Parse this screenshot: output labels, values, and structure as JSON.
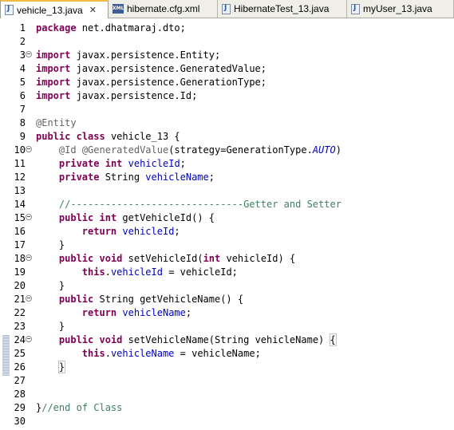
{
  "tabs": [
    {
      "label": "vehicle_13.java",
      "icon": "java-file-icon",
      "active": true,
      "close": "✕"
    },
    {
      "label": "hibernate.cfg.xml",
      "icon": "xml-file-icon",
      "active": false
    },
    {
      "label": "HibernateTest_13.java",
      "icon": "java-file-icon",
      "active": false
    },
    {
      "label": "myUser_13.java",
      "icon": "java-file-icon",
      "active": false
    }
  ],
  "xml_badge": "XML",
  "lines": [
    {
      "n": "1",
      "fold": false,
      "parts": [
        [
          "kw",
          "package"
        ],
        [
          "",
          "net.dhatmaraj.dto;"
        ]
      ],
      "html": "<span class='kw'>package</span> net.dhatmaraj.dto;"
    },
    {
      "n": "2",
      "fold": false,
      "parts": []
    },
    {
      "n": "3",
      "fold": true,
      "parts": []
    },
    {
      "n": "4",
      "fold": false,
      "parts": []
    },
    {
      "n": "5",
      "fold": false,
      "parts": []
    },
    {
      "n": "6",
      "fold": false,
      "parts": []
    },
    {
      "n": "7",
      "fold": false,
      "parts": []
    },
    {
      "n": "8",
      "fold": false,
      "parts": []
    },
    {
      "n": "9",
      "fold": false,
      "parts": []
    },
    {
      "n": "10",
      "fold": true,
      "parts": []
    },
    {
      "n": "11",
      "fold": false,
      "parts": []
    },
    {
      "n": "12",
      "fold": false,
      "parts": []
    },
    {
      "n": "13",
      "fold": false,
      "parts": []
    },
    {
      "n": "14",
      "fold": false,
      "parts": []
    },
    {
      "n": "15",
      "fold": true,
      "parts": []
    },
    {
      "n": "16",
      "fold": false,
      "parts": []
    },
    {
      "n": "17",
      "fold": false,
      "parts": []
    },
    {
      "n": "18",
      "fold": true,
      "parts": []
    },
    {
      "n": "19",
      "fold": false,
      "parts": []
    },
    {
      "n": "20",
      "fold": false,
      "parts": []
    },
    {
      "n": "21",
      "fold": true,
      "parts": []
    },
    {
      "n": "22",
      "fold": false,
      "parts": []
    },
    {
      "n": "23",
      "fold": false,
      "parts": []
    },
    {
      "n": "24",
      "fold": true,
      "parts": []
    },
    {
      "n": "25",
      "fold": false,
      "parts": []
    },
    {
      "n": "26",
      "fold": false,
      "parts": []
    },
    {
      "n": "27",
      "fold": false,
      "parts": []
    },
    {
      "n": "28",
      "fold": false,
      "parts": []
    },
    {
      "n": "29",
      "fold": false,
      "parts": []
    },
    {
      "n": "30",
      "fold": false,
      "parts": []
    }
  ],
  "code": {
    "l1_kw": "package",
    "l1_rest": " net.dhatmaraj.dto;",
    "l3_kw": "import",
    "l3_rest": " javax.persistence.Entity;",
    "l4_kw": "import",
    "l4_rest": " javax.persistence.GeneratedValue;",
    "l5_kw": "import",
    "l5_rest": " javax.persistence.GenerationType;",
    "l6_kw": "import",
    "l6_rest": " javax.persistence.Id;",
    "l8_ann": "@Entity",
    "l9_kw1": "public",
    "l9_kw2": "class",
    "l9_rest": " vehicle_13 {",
    "l10_indent": "    ",
    "l10_ann1": "@Id",
    "l10_ann2": "@GeneratedValue",
    "l10_rest": "(strategy=GenerationType.",
    "l10_it": "AUTO",
    "l10_end": ")",
    "l11_kw1": "private",
    "l11_kw2": "int",
    "l11_fld": "vehicleId",
    "l11_end": ";",
    "l12_kw1": "private",
    "l12_type": " String ",
    "l12_fld": "vehicleName",
    "l12_end": ";",
    "l14_cmt": "//------------------------------Getter and Setter",
    "l15_kw1": "public",
    "l15_kw2": "int",
    "l15_rest": " getVehicleId() {",
    "l16_kw": "return",
    "l16_fld": "vehicleId",
    "l16_end": ";",
    "l17_rest": "}",
    "l18_kw1": "public",
    "l18_kw2": "void",
    "l18_rest1": " setVehicleId(",
    "l18_kw3": "int",
    "l18_rest2": " vehicleId) {",
    "l19_kw": "this",
    "l19_dot": ".",
    "l19_fld": "vehicleId",
    "l19_rest": " = vehicleId;",
    "l20_rest": "}",
    "l21_kw1": "public",
    "l21_rest": " String getVehicleName() {",
    "l22_kw": "return",
    "l22_fld": "vehicleName",
    "l22_end": ";",
    "l23_rest": "}",
    "l24_kw1": "public",
    "l24_kw2": "void",
    "l24_rest": " setVehicleName(String vehicleName) ",
    "l24_brace": "{",
    "l25_kw": "this",
    "l25_dot": ".",
    "l25_fld": "vehicleName",
    "l25_rest": " = vehicleName;",
    "l26_brace": "}",
    "l29_brace": "}",
    "l29_cmt": "//end of Class"
  }
}
